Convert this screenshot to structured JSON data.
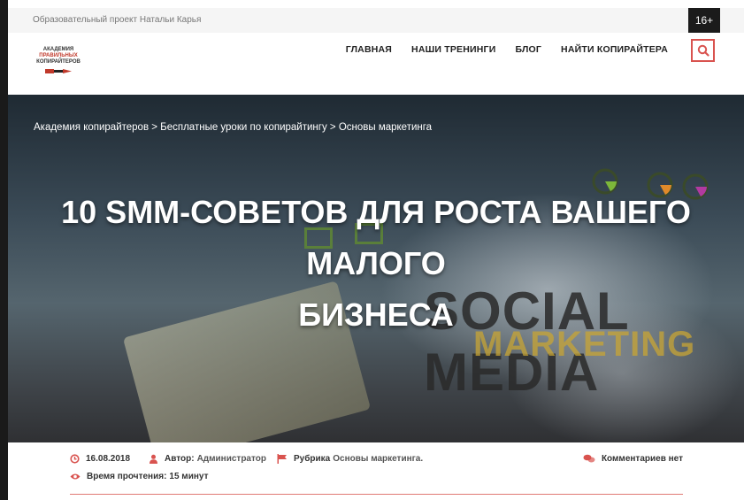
{
  "topbar": {
    "project": "Образовательный проект Натальи Карья",
    "age": "16+"
  },
  "logo": {
    "line1": "АКАДЕМИЯ",
    "line2": "ПРАВИЛЬНЫХ",
    "line3": "КОПИРАЙТЕРОВ"
  },
  "nav": {
    "items": [
      "ГЛАВНАЯ",
      "НАШИ ТРЕНИНГИ",
      "БЛОГ",
      "НАЙТИ КОПИРАЙТЕРА"
    ]
  },
  "hero": {
    "breadcrumb": "Академия копирайтеров > Бесплатные уроки по копирайтингу > Основы маркетинга",
    "title_line1": "10 SMM-СОВЕТОВ ДЛЯ РОСТА ВАШЕГО МАЛОГО",
    "title_line2": "БИЗНЕСА",
    "image_text1": "SOCIAL MEDIA",
    "image_text2": "MARKETING"
  },
  "meta": {
    "date": "16.08.2018",
    "author_label": "Автор:",
    "author": "Администратор",
    "rubric_label": "Рубрика",
    "rubric": "Основы маркетинга.",
    "comments": "Комментариев нет",
    "reading_label": "Время прочтения:",
    "reading": "15 минут"
  },
  "colors": {
    "accent": "#d9534f",
    "dark": "#1b1b1b"
  }
}
